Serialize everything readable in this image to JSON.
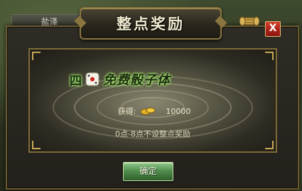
{
  "location": {
    "name": "盐泽"
  },
  "dialog": {
    "title": "整点奖励",
    "headline": {
      "prefix": "四",
      "main": "免费骰子体"
    },
    "reward": {
      "label": "获得:",
      "amount": "10000",
      "icon": "gold-ingot-icon"
    },
    "note": "0点-8点不设整点奖励",
    "confirm_label": "确定",
    "close_label": "X"
  },
  "colors": {
    "frame_gold": "#8a7540",
    "close_red": "#d23a2a",
    "confirm_green": "#4e8a4a",
    "headline_glow": "#9be070"
  }
}
